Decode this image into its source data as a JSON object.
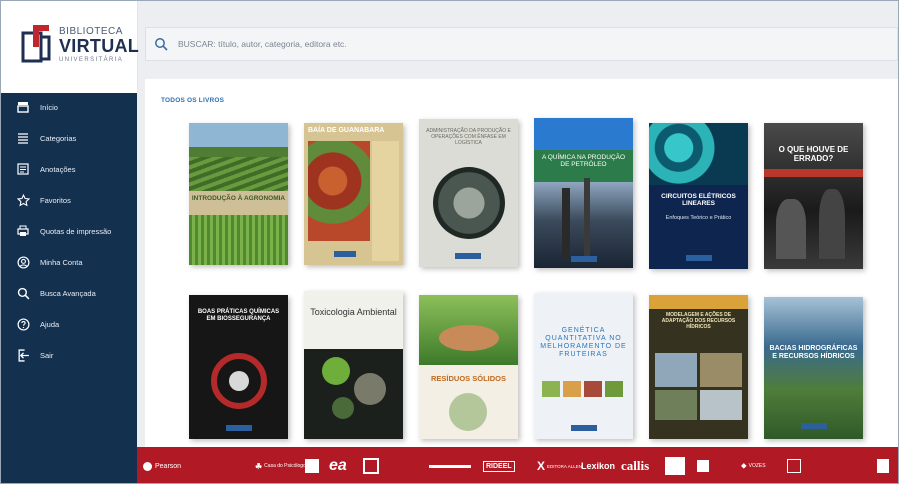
{
  "logo": {
    "top": "BIBLIOTECA",
    "main": "VIRTUAL",
    "sub": "UNIVERSITÁRIA"
  },
  "nav": [
    {
      "label": "Início",
      "icon": "home-icon"
    },
    {
      "label": "Categorias",
      "icon": "list-icon"
    },
    {
      "label": "Anotações",
      "icon": "notes-icon"
    },
    {
      "label": "Favoritos",
      "icon": "star-icon"
    },
    {
      "label": "Quotas de impressão",
      "icon": "printer-icon"
    },
    {
      "label": "Minha Conta",
      "icon": "user-icon"
    },
    {
      "label": "Busca Avançada",
      "icon": "search-icon"
    },
    {
      "label": "Ajuda",
      "icon": "help-icon"
    },
    {
      "label": "Sair",
      "icon": "logout-icon"
    }
  ],
  "search": {
    "placeholder": "BUSCAR: título, autor, categoria, editora etc."
  },
  "section_title": "TODOS OS LIVROS",
  "books": [
    {
      "title": "INTRODUÇÃO À AGRONOMIA",
      "colors": [
        "#5f8f3a",
        "#c2a777",
        "#3c6b2a"
      ]
    },
    {
      "title": "BAÍA DE GUANABARA",
      "colors": [
        "#b7482b",
        "#d9c08a",
        "#6a9a4a"
      ]
    },
    {
      "title": "ADMINISTRAÇÃO DA PRODUÇÃO E OPERAÇÕES COM ÊNFASE EM LOGÍSTICA",
      "colors": [
        "#c9cbc6",
        "#5e6a62",
        "#2f3b34"
      ]
    },
    {
      "title": "A QUÍMICA NA PRODUÇÃO DE PETRÓLEO",
      "colors": [
        "#2a6fb1",
        "#2f7a45",
        "#1c2a3a"
      ]
    },
    {
      "title": "CIRCUITOS ELÉTRICOS LINEARES",
      "subtitle": "Enfoques Teórico e Prático",
      "colors": [
        "#0f2a55",
        "#25b2b7",
        "#081b3c"
      ]
    },
    {
      "title": "O QUE HOUVE DE ERRADO?",
      "colors": [
        "#3b3b3b",
        "#b9372b",
        "#1b1b1b"
      ]
    },
    {
      "title": "BOAS PRÁTICAS QUÍMICAS EM BIOSSEGURANÇA",
      "colors": [
        "#222222",
        "#b42a2a",
        "#111111"
      ]
    },
    {
      "title": "Toxicologia Ambiental",
      "colors": [
        "#2c2f2a",
        "#6fae3a",
        "#141614"
      ]
    },
    {
      "title": "RESÍDUOS SÓLIDOS",
      "colors": [
        "#6aa74a",
        "#d88a2f",
        "#f3efe4"
      ]
    },
    {
      "title": "GENÉTICA QUANTITATIVA NO MELHORAMENTO DE FRUTEIRAS",
      "colors": [
        "#e9eef3",
        "#2b75b8",
        "#8bb34f"
      ]
    },
    {
      "title": "MODELAGEM E AÇÕES DE ADAPTAÇÃO DOS RECURSOS HÍDRICOS",
      "colors": [
        "#3b3a25",
        "#d9a33a",
        "#8fa7b8"
      ]
    },
    {
      "title": "BACIAS HIDROGRÁFICAS E RECURSOS HÍDRICOS",
      "colors": [
        "#3a6a8f",
        "#5f8a3a",
        "#ffffff"
      ]
    }
  ],
  "footer": {
    "publishers": [
      "Pearson",
      "Casa do Psicólogo",
      "EDITORA ALLEN",
      "Lexikon",
      "callis",
      "RIDEEL",
      "VOZES"
    ]
  }
}
